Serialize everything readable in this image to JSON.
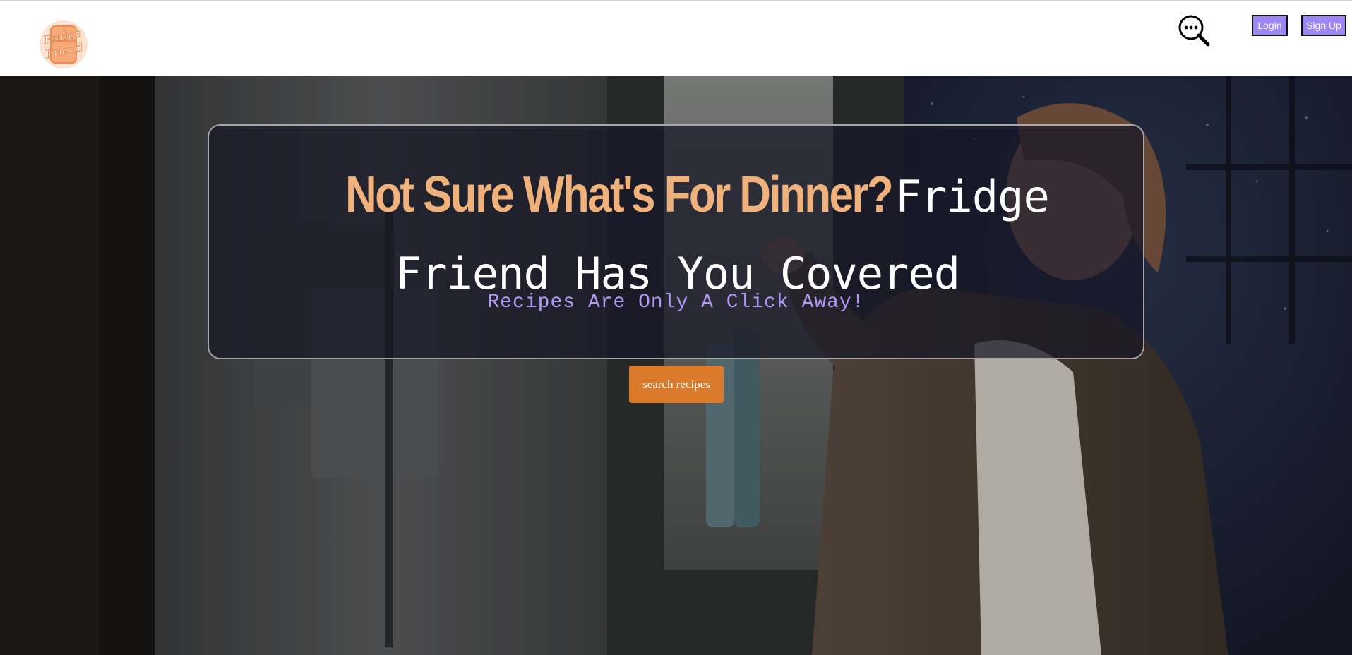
{
  "header": {
    "logo": {
      "line1": "Fridge",
      "line2": "Friend",
      "icon": "fridge-friend-logo"
    },
    "search_icon": "search-icon",
    "login_label": "Login",
    "signup_label": "Sign Up"
  },
  "hero": {
    "headline_accent": "Not Sure What's For Dinner?",
    "headline_rest": "Fridge Friend Has You Covered",
    "tagline": "Recipes Are Only A Click Away!",
    "cta_label": "search recipes"
  },
  "colors": {
    "accent_orange": "#efb27c",
    "button_orange": "#db7a2a",
    "purple": "#9b86f3",
    "tagline_purple": "#b397f5"
  }
}
